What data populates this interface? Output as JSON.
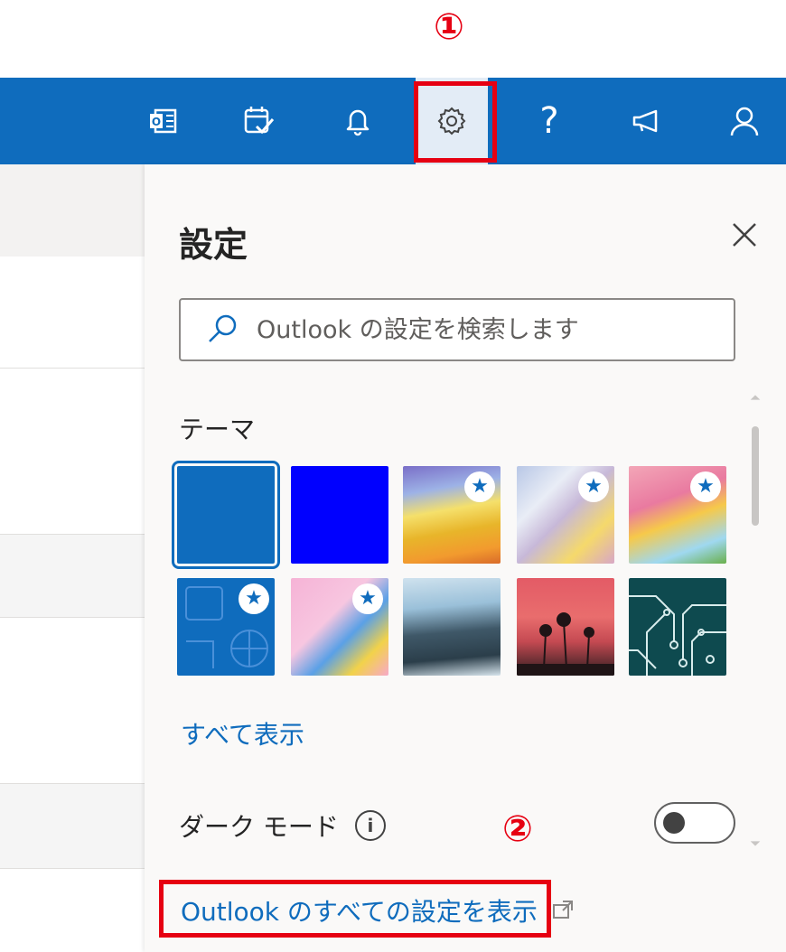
{
  "markers": {
    "step1": "①",
    "step2": "②"
  },
  "topbar": {
    "icons": [
      "office-icon",
      "calendar-check-icon",
      "bell-icon",
      "gear-icon",
      "help-icon",
      "megaphone-icon",
      "person-icon"
    ],
    "help_glyph": "?"
  },
  "panel": {
    "title": "設定",
    "search_placeholder": "Outlook の設定を検索します",
    "theme_label": "テーマ",
    "star_glyph": "★",
    "see_all": "すべて表示",
    "dark_mode_label": "ダーク モード",
    "info_glyph": "i",
    "dark_mode_on": false,
    "all_settings_link": "Outlook のすべての設定を表示"
  },
  "colors": {
    "brand": "#0f6cbd",
    "highlight": "#e60012",
    "blue_theme": "#0000ff"
  }
}
